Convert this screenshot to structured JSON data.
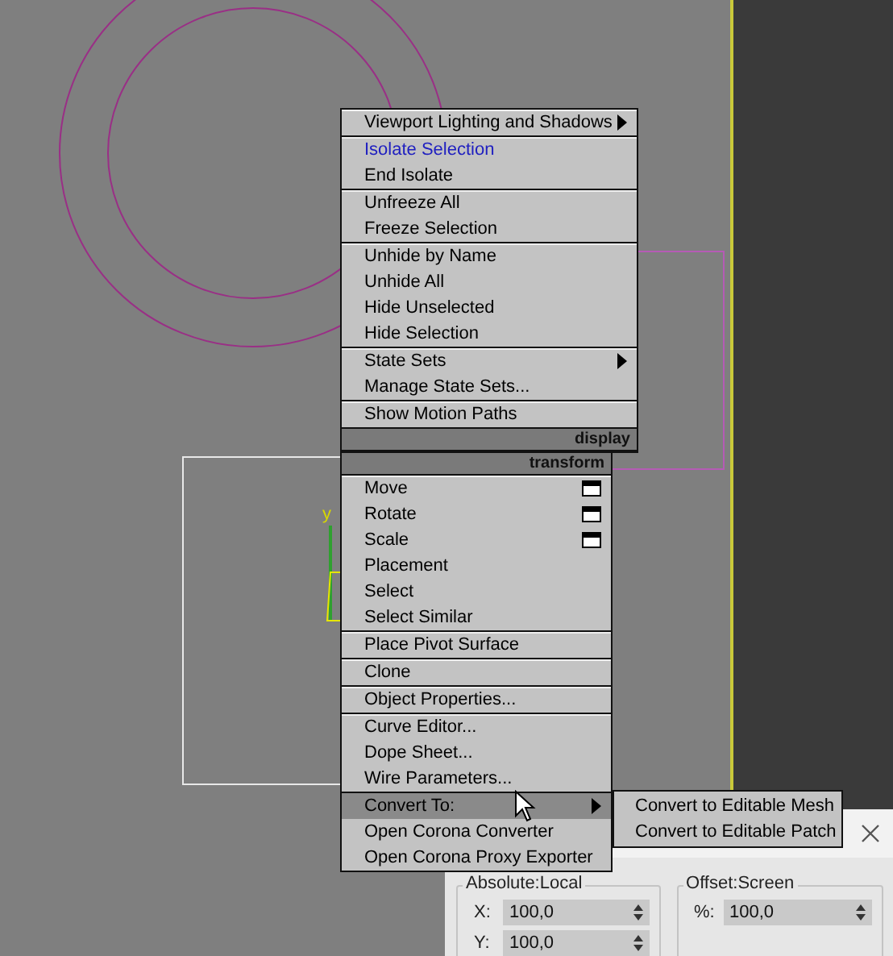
{
  "viewport": {
    "axis_label": "y"
  },
  "quad_menu": {
    "display": {
      "title": "display",
      "groups": [
        {
          "items": [
            {
              "label": "Viewport Lighting and Shadows",
              "kind": "submenu",
              "selected": false,
              "last_used": false
            }
          ]
        },
        {
          "items": [
            {
              "label": "Isolate Selection",
              "kind": "command",
              "selected": false,
              "last_used": true
            },
            {
              "label": "End Isolate",
              "kind": "command",
              "selected": false,
              "last_used": false
            }
          ]
        },
        {
          "items": [
            {
              "label": "Unfreeze All",
              "kind": "command",
              "selected": false,
              "last_used": false
            },
            {
              "label": "Freeze Selection",
              "kind": "command",
              "selected": false,
              "last_used": false
            }
          ]
        },
        {
          "items": [
            {
              "label": "Unhide by Name",
              "kind": "command",
              "selected": false,
              "last_used": false
            },
            {
              "label": "Unhide All",
              "kind": "command",
              "selected": false,
              "last_used": false
            },
            {
              "label": "Hide Unselected",
              "kind": "command",
              "selected": false,
              "last_used": false
            },
            {
              "label": "Hide Selection",
              "kind": "command",
              "selected": false,
              "last_used": false
            }
          ]
        },
        {
          "items": [
            {
              "label": "State Sets",
              "kind": "submenu",
              "selected": false,
              "last_used": false
            },
            {
              "label": "Manage State Sets...",
              "kind": "command",
              "selected": false,
              "last_used": false
            }
          ]
        },
        {
          "items": [
            {
              "label": "Show Motion Paths",
              "kind": "command",
              "selected": false,
              "last_used": false
            }
          ]
        }
      ]
    },
    "transform": {
      "title": "transform",
      "groups": [
        {
          "items": [
            {
              "label": "Move",
              "kind": "options",
              "selected": false,
              "last_used": false
            },
            {
              "label": "Rotate",
              "kind": "options",
              "selected": false,
              "last_used": false
            },
            {
              "label": "Scale",
              "kind": "options",
              "selected": false,
              "last_used": false
            },
            {
              "label": "Placement",
              "kind": "command",
              "selected": false,
              "last_used": false
            },
            {
              "label": "Select",
              "kind": "command",
              "selected": false,
              "last_used": false
            },
            {
              "label": "Select Similar",
              "kind": "command",
              "selected": false,
              "last_used": false
            }
          ]
        },
        {
          "items": [
            {
              "label": "Place Pivot Surface",
              "kind": "command",
              "selected": false,
              "last_used": false
            }
          ]
        },
        {
          "items": [
            {
              "label": "Clone",
              "kind": "command",
              "selected": false,
              "last_used": false
            }
          ]
        },
        {
          "items": [
            {
              "label": "Object Properties...",
              "kind": "command",
              "selected": false,
              "last_used": false
            }
          ]
        },
        {
          "items": [
            {
              "label": "Curve Editor...",
              "kind": "command",
              "selected": false,
              "last_used": false
            },
            {
              "label": "Dope Sheet...",
              "kind": "command",
              "selected": false,
              "last_used": false
            },
            {
              "label": "Wire Parameters...",
              "kind": "command",
              "selected": false,
              "last_used": false
            }
          ]
        },
        {
          "items": [
            {
              "label": "Convert To:",
              "kind": "submenu",
              "selected": true,
              "last_used": false
            },
            {
              "label": "Open Corona Converter",
              "kind": "command",
              "selected": false,
              "last_used": false
            },
            {
              "label": "Open Corona Proxy Exporter",
              "kind": "command",
              "selected": false,
              "last_used": false
            }
          ]
        }
      ]
    },
    "submenu": {
      "items": [
        {
          "label": "Convert to Editable Mesh",
          "selected": false
        },
        {
          "label": "Convert to Editable Patch",
          "selected": false
        }
      ]
    }
  },
  "dialog": {
    "groups": [
      {
        "title": "Absolute:Local",
        "fields": [
          {
            "label": "X:",
            "value": "100,0"
          },
          {
            "label": "Y:",
            "value": "100,0"
          }
        ]
      },
      {
        "title": "Offset:Screen",
        "fields": [
          {
            "label": "%:",
            "value": "100,0"
          }
        ]
      }
    ]
  }
}
